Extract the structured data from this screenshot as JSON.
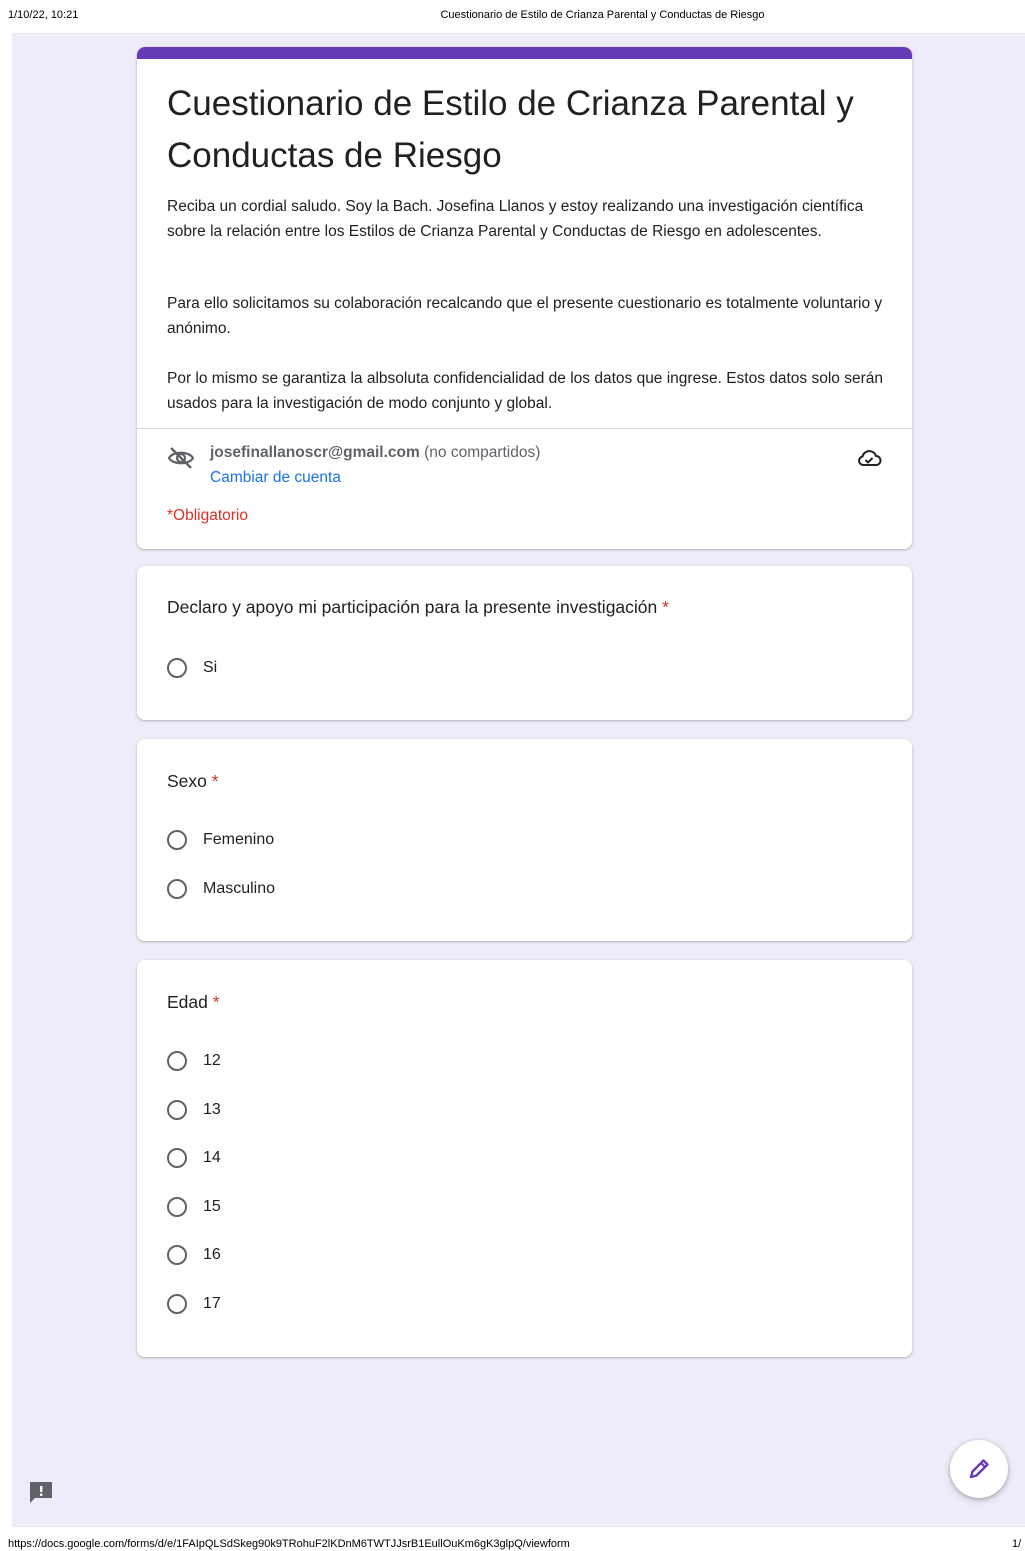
{
  "print_header": {
    "date": "1/10/22, 10:21",
    "title": "Cuestionario de Estilo de Crianza Parental y Conductas de Riesgo"
  },
  "form": {
    "title": "Cuestionario de Estilo de Crianza Parental y Conductas de Riesgo",
    "description": [
      "Reciba un cordial saludo. Soy la Bach. Josefina Llanos y estoy realizando una investigación científica sobre la relación entre los Estilos de Crianza Parental y Conductas de Riesgo en adolescentes.",
      "Para ello solicitamos su colaboración recalcando que el presente cuestionario es totalmente voluntario y anónimo.",
      "Por lo mismo se garantiza la albsoluta confidencialidad de los datos que ingrese. Estos datos solo serán usados para la investigación de modo conjunto y global."
    ],
    "account": {
      "email": "josefinallanoscr@gmail.com",
      "not_shared": "(no compartidos)",
      "switch_label": "Cambiar de cuenta"
    },
    "required_note": "*Obligatorio",
    "accent_color": "#673ab7"
  },
  "questions": [
    {
      "title": "Declaro y apoyo mi participación para la presente investigación",
      "required_mark": "*",
      "options": [
        "Si"
      ]
    },
    {
      "title": "Sexo",
      "required_mark": "*",
      "options": [
        "Femenino",
        "Masculino"
      ]
    },
    {
      "title": "Edad",
      "required_mark": "*",
      "options": [
        "12",
        "13",
        "14",
        "15",
        "16",
        "17"
      ]
    }
  ],
  "icons": {
    "visibility": "visibility-off-icon",
    "cloud": "cloud-sync-icon",
    "edit": "pencil-icon",
    "feedback": "feedback-icon"
  },
  "print_footer": {
    "url": "https://docs.google.com/forms/d/e/1FAIpQLSdSkeg90k9TRohuF2lKDnM6TWTJJsrB1EullOuKm6gK3glpQ/viewform",
    "page": "1/"
  }
}
